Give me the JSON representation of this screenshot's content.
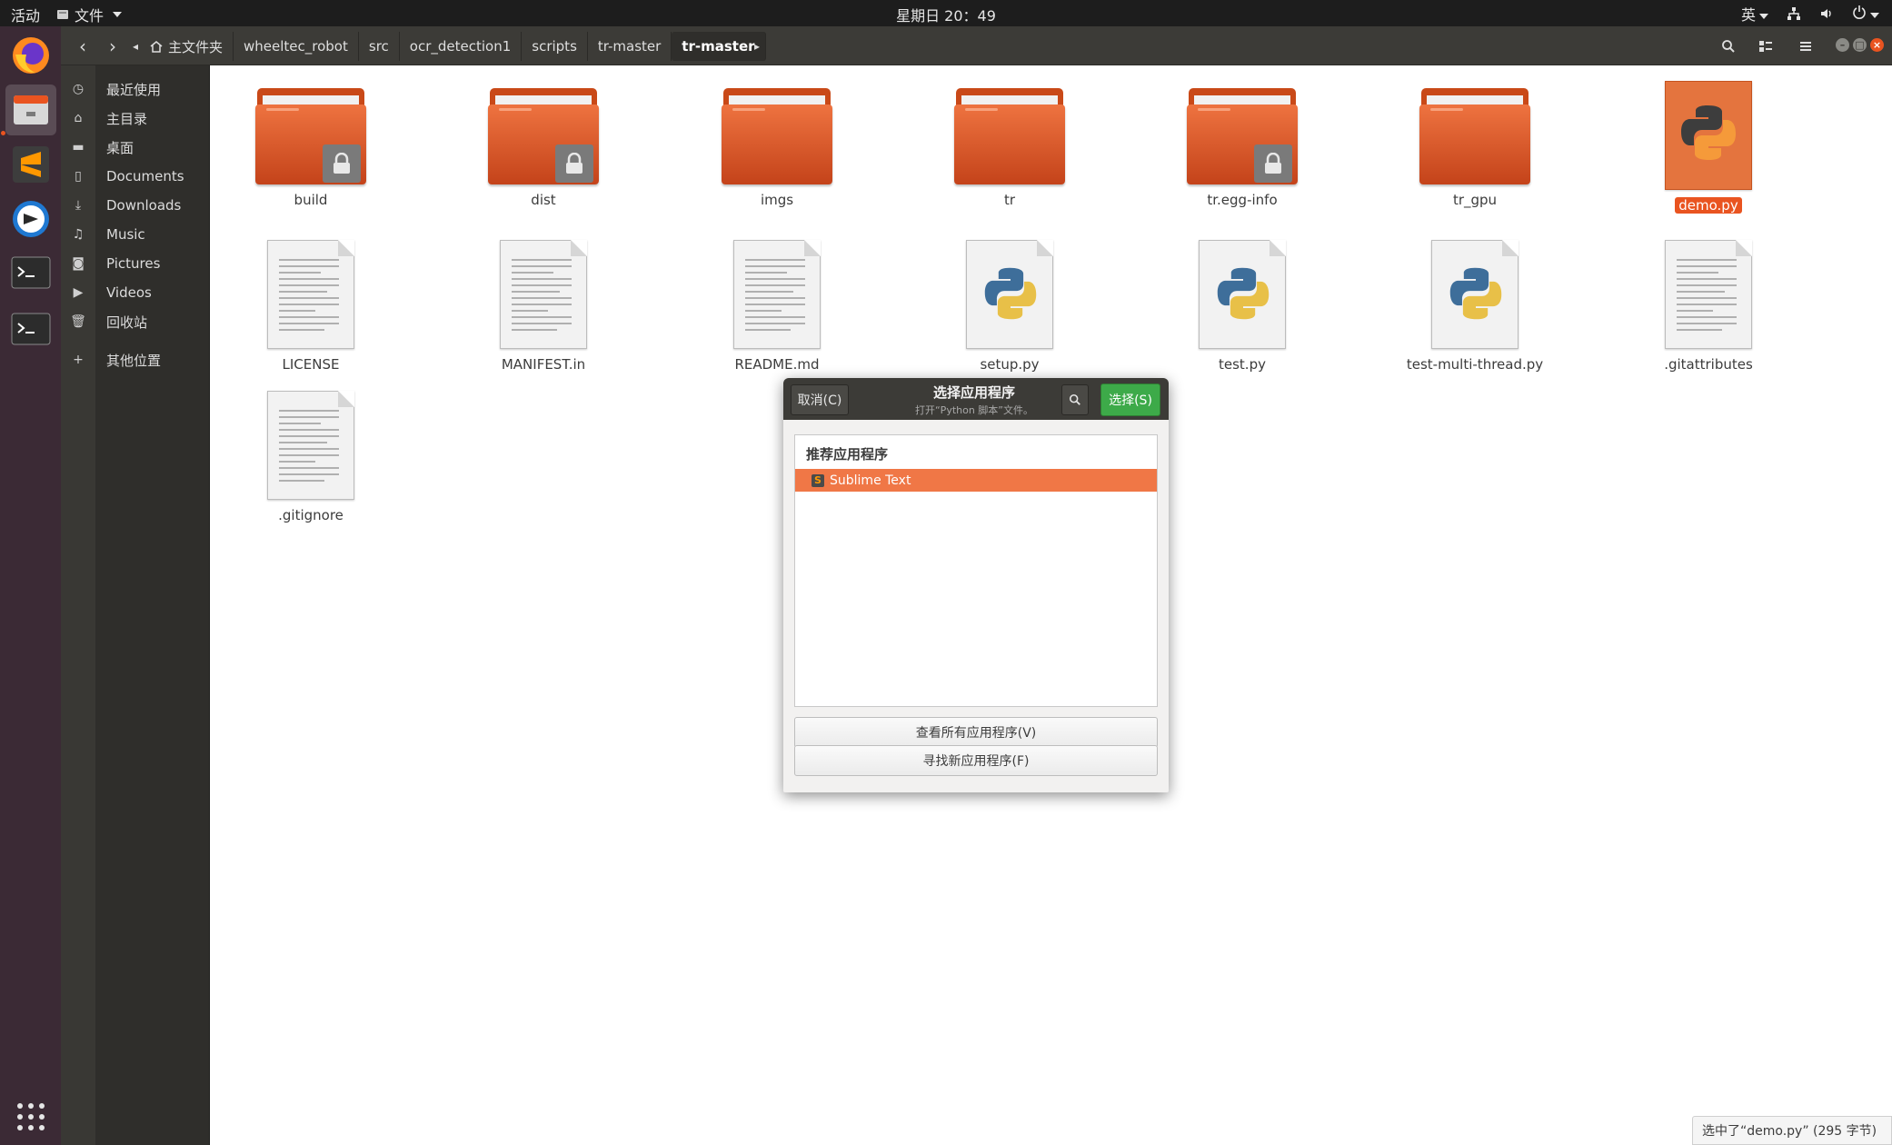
{
  "top_panel": {
    "activities": "活动",
    "app_menu": "文件",
    "clock": "星期日 20：49",
    "input_method": "英"
  },
  "dock": {
    "items": [
      {
        "icon": "firefox-icon"
      },
      {
        "icon": "files-icon"
      },
      {
        "icon": "sublime-text-icon"
      },
      {
        "icon": "app-icon"
      },
      {
        "icon": "terminal-icon"
      },
      {
        "icon": "terminal-icon"
      }
    ]
  },
  "pathbar": {
    "home": "主文件夹",
    "crumbs": [
      "wheeltec_robot",
      "src",
      "ocr_detection1",
      "scripts",
      "tr-master",
      "tr-master"
    ]
  },
  "sidebar": {
    "items": [
      {
        "label": "最近使用",
        "icon": "recent-icon"
      },
      {
        "label": "主目录",
        "icon": "home-icon"
      },
      {
        "label": "桌面",
        "icon": "folder-icon"
      },
      {
        "label": "Documents",
        "icon": "document-icon"
      },
      {
        "label": "Downloads",
        "icon": "download-icon"
      },
      {
        "label": "Music",
        "icon": "music-icon"
      },
      {
        "label": "Pictures",
        "icon": "camera-icon"
      },
      {
        "label": "Videos",
        "icon": "video-icon"
      },
      {
        "label": "回收站",
        "icon": "trash-icon"
      },
      {
        "label": "其他位置",
        "icon": "plus-icon"
      }
    ]
  },
  "files": [
    {
      "name": "build",
      "kind": "folder",
      "locked": true
    },
    {
      "name": "dist",
      "kind": "folder",
      "locked": true
    },
    {
      "name": "imgs",
      "kind": "folder",
      "locked": false
    },
    {
      "name": "tr",
      "kind": "folder",
      "locked": false
    },
    {
      "name": "tr.egg-info",
      "kind": "folder",
      "locked": true
    },
    {
      "name": "tr_gpu",
      "kind": "folder",
      "locked": false
    },
    {
      "name": "demo.py",
      "kind": "python-selected",
      "selected": true
    },
    {
      "name": "LICENSE",
      "kind": "text"
    },
    {
      "name": "MANIFEST.in",
      "kind": "text"
    },
    {
      "name": "README.md",
      "kind": "text"
    },
    {
      "name": "setup.py",
      "kind": "python"
    },
    {
      "name": "test.py",
      "kind": "python"
    },
    {
      "name": "test-multi-thread.py",
      "kind": "python"
    },
    {
      "name": ".gitattributes",
      "kind": "text"
    },
    {
      "name": ".gitignore",
      "kind": "text"
    }
  ],
  "dialog": {
    "cancel": "取消(C)",
    "title": "选择应用程序",
    "subtitle": "打开“Python 脚本”文件。",
    "select": "选择(S)",
    "section_header": "推荐应用程序",
    "app": "Sublime Text",
    "view_all": "查看所有应用程序(V)",
    "find_new": "寻找新应用程序(F)"
  },
  "status": "选中了“demo.py” (295 字节)",
  "colors": {
    "accent": "#e95420",
    "select_button": "#3daa49",
    "highlight_row": "#f07746"
  }
}
